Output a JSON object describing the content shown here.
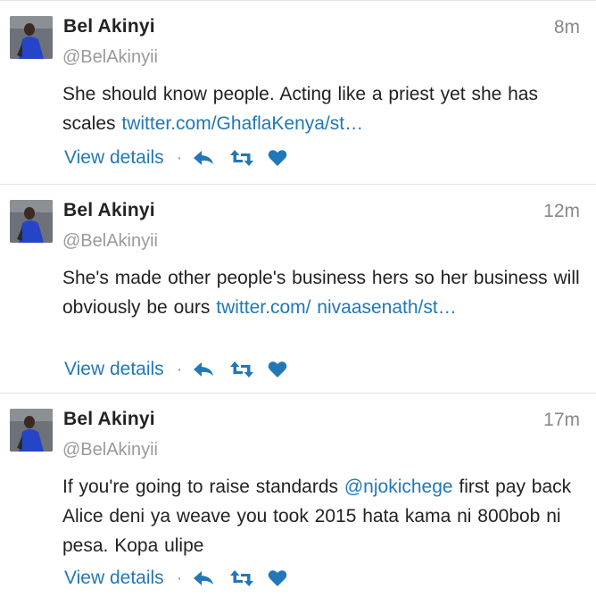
{
  "colors": {
    "link": "#2277b8",
    "action_icon": "#2277b8",
    "muted": "#9a9a9a"
  },
  "tweets": [
    {
      "name": "Bel Akinyi",
      "handle": "@BelAkinyii",
      "time": "8m",
      "text": "She should know people. Acting like a priest yet she has scales ",
      "link": "twitter.com/GhaflaKenya/st…",
      "text_after": "",
      "view_details": "View details",
      "separator": "·",
      "icons": [
        "reply-icon",
        "retweet-icon",
        "favorite-icon"
      ]
    },
    {
      "name": "Bel Akinyi",
      "handle": "@BelAkinyii",
      "time": "12m",
      "text": "She's made other people's business hers so her business will obviously be ours ",
      "link": "twitter.com/ nivaasenath/st…",
      "text_after": "",
      "view_details": "View details",
      "separator": "·",
      "icons": [
        "reply-icon",
        "retweet-icon",
        "favorite-icon"
      ]
    },
    {
      "name": "Bel Akinyi",
      "handle": "@BelAkinyii",
      "time": "17m",
      "text": "If you're going to raise standards ",
      "link": "@njokichege",
      "text_after": " first pay back Alice deni ya weave you took 2015 hata kama ni 800bob ni pesa. Kopa ulipe",
      "view_details": "View details",
      "separator": "·",
      "icons": [
        "reply-icon",
        "retweet-icon",
        "favorite-icon"
      ]
    }
  ]
}
